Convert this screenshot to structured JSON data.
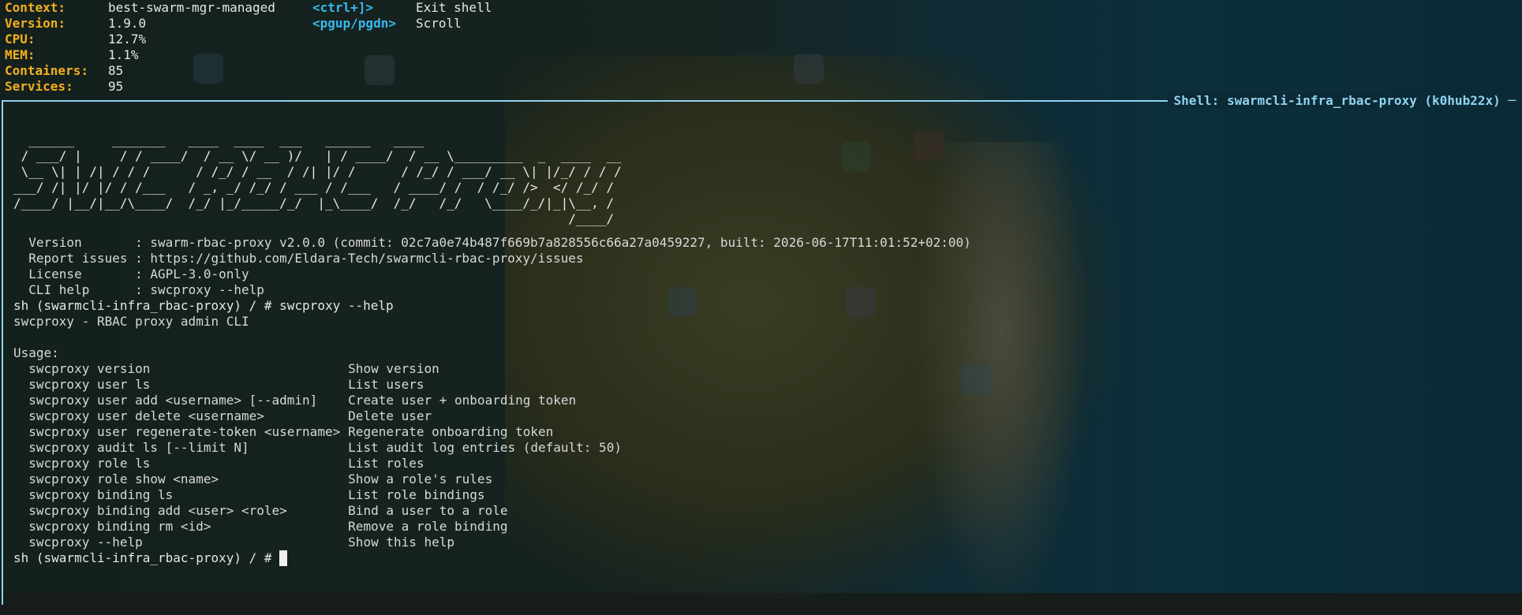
{
  "status": {
    "rows": [
      {
        "key": "Context:",
        "value": "best-swarm-mgr-managed"
      },
      {
        "key": "Version:",
        "value": "1.9.0"
      },
      {
        "key": "CPU:",
        "value": "12.7%"
      },
      {
        "key": "MEM:",
        "value": "1.1%"
      },
      {
        "key": "Containers:",
        "value": "85"
      },
      {
        "key": "Services:",
        "value": "95"
      }
    ]
  },
  "keybindings": [
    {
      "key": "<ctrl+]>",
      "desc": "Exit shell"
    },
    {
      "key": "<pgup/pgdn>",
      "desc": "Scroll"
    }
  ],
  "pane": {
    "title": "Shell: swarmcli-infra_rbac-proxy (k0hub22x)",
    "border_color": "#8fd3f0"
  },
  "banner": [
    "  ______     _______   ____  ____  ___   ______   ____",
    " / ___/ |     / / ____/  / __ \\/ __ )/   | / ____/  / __ \\_________  _  ____  __",
    " \\__ \\| | /| / / /      / /_/ / __  / /| |/ /      / /_/ / ___/ __ \\| |/_/ / / /",
    "___/ /| |/ |/ / /___   / _, _/ /_/ / ___ / /___   / ____/ /  / /_/ />  </ /_/ /",
    "/____/ |__/|__/\\____/  /_/ |_/_____/_/  |_\\____/  /_/   /_/   \\____/_/|_|\\__, /",
    "                                                                         /____/"
  ],
  "info": [
    {
      "label": "Version      ",
      "value": "swarm-rbac-proxy v2.0.0 (commit: 02c7a0e74b487f669b7a828556c66a27a0459227, built: 2026-06-17T11:01:52+02:00)"
    },
    {
      "label": "Report issues",
      "value": "https://github.com/Eldara-Tech/swarmcli-rbac-proxy/issues"
    },
    {
      "label": "License      ",
      "value": "AGPL-3.0-only"
    },
    {
      "label": "CLI help     ",
      "value": "swcproxy --help"
    }
  ],
  "prompt1": "sh (swarmcli-infra_rbac-proxy) / # swcproxy --help",
  "help_title": "swcproxy - RBAC proxy admin CLI",
  "usage_header": "Usage:",
  "usage": [
    {
      "cmd": "swcproxy version",
      "desc": "Show version"
    },
    {
      "cmd": "swcproxy user ls",
      "desc": "List users"
    },
    {
      "cmd": "swcproxy user add <username> [--admin]",
      "desc": "Create user + onboarding token"
    },
    {
      "cmd": "swcproxy user delete <username>",
      "desc": "Delete user"
    },
    {
      "cmd": "swcproxy user regenerate-token <username>",
      "desc": "Regenerate onboarding token"
    },
    {
      "cmd": "swcproxy audit ls [--limit N]",
      "desc": "List audit log entries (default: 50)"
    },
    {
      "cmd": "swcproxy role ls",
      "desc": "List roles"
    },
    {
      "cmd": "swcproxy role show <name>",
      "desc": "Show a role's rules"
    },
    {
      "cmd": "swcproxy binding ls",
      "desc": "List role bindings"
    },
    {
      "cmd": "swcproxy binding add <user> <role>",
      "desc": "Bind a user to a role"
    },
    {
      "cmd": "swcproxy binding rm <id>",
      "desc": "Remove a role binding"
    },
    {
      "cmd": "swcproxy --help",
      "desc": "Show this help"
    }
  ],
  "prompt2": "sh (swarmcli-infra_rbac-proxy) / # "
}
